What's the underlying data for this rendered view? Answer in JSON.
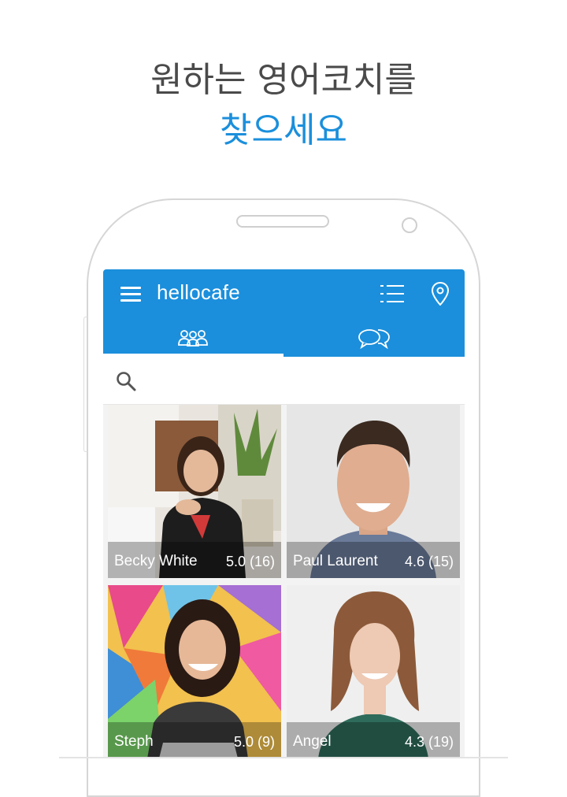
{
  "headline": {
    "line1": "원하는 영어코치를",
    "line2": "찾으세요"
  },
  "app": {
    "title": "hellocafe",
    "icons": {
      "menu": "hamburger-menu-icon",
      "list": "list-view-icon",
      "location": "location-pin-icon"
    },
    "tabs": [
      {
        "name": "coaches",
        "icon": "people-group-icon",
        "active": true
      },
      {
        "name": "chat",
        "icon": "chat-bubbles-icon",
        "active": false
      }
    ],
    "search": {
      "icon": "search-icon",
      "placeholder": ""
    }
  },
  "coaches": [
    {
      "name": "Becky White",
      "rating": "5.0 (16)"
    },
    {
      "name": "Paul Laurent",
      "rating": "4.6 (15)"
    },
    {
      "name": "Steph",
      "rating": "5.0 (9)"
    },
    {
      "name": "Angel",
      "rating": "4.3 (19)"
    }
  ],
  "colors": {
    "accent": "#1b8fdc",
    "headline_text": "#4a4a4a"
  }
}
